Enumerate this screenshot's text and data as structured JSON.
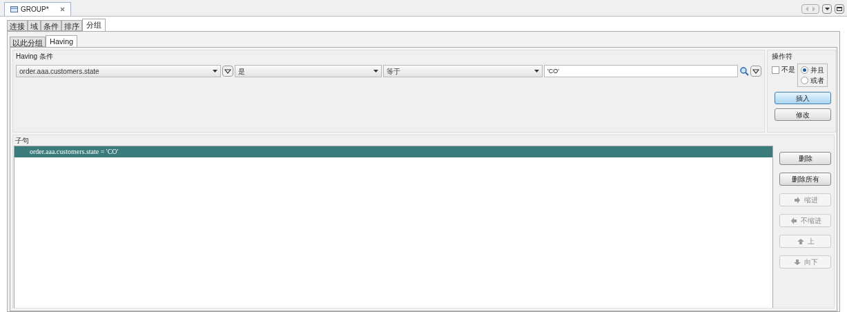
{
  "editor_tab": {
    "title": "GROUP*"
  },
  "tabs": [
    {
      "label": "连接",
      "selected": false
    },
    {
      "label": "域",
      "selected": false
    },
    {
      "label": "条件",
      "selected": false
    },
    {
      "label": "排序",
      "selected": false
    },
    {
      "label": "分组",
      "selected": true
    }
  ],
  "sub_tabs": [
    {
      "label": "以此分组",
      "selected": false
    },
    {
      "label": "Having",
      "selected": true
    }
  ],
  "having": {
    "title": "Having 条件",
    "field": "order.aaa.customers.state",
    "function": "是",
    "operator": "等于",
    "value": "'CO'"
  },
  "operators": {
    "title": "操作符",
    "not": {
      "label": "不是",
      "checked": false
    },
    "radios": [
      {
        "label": "并且",
        "selected": true
      },
      {
        "label": "或者",
        "selected": false
      }
    ],
    "buttons": [
      {
        "label": "插入",
        "focused": true
      },
      {
        "label": "修改",
        "focused": false
      }
    ]
  },
  "clauses": {
    "title": "子句",
    "items": [
      {
        "text": "order.aaa.customers.state = 'CO'",
        "selected": true
      }
    ]
  },
  "clause_buttons": [
    {
      "label": "删除",
      "kind": "plain",
      "disabled": false
    },
    {
      "label": "删除所有",
      "kind": "plain",
      "disabled": false
    },
    {
      "label": "缩进",
      "kind": "right",
      "disabled": true
    },
    {
      "label": "不缩进",
      "kind": "left",
      "disabled": true
    },
    {
      "label": "上",
      "kind": "up",
      "disabled": true
    },
    {
      "label": "向下",
      "kind": "down",
      "disabled": true
    }
  ]
}
